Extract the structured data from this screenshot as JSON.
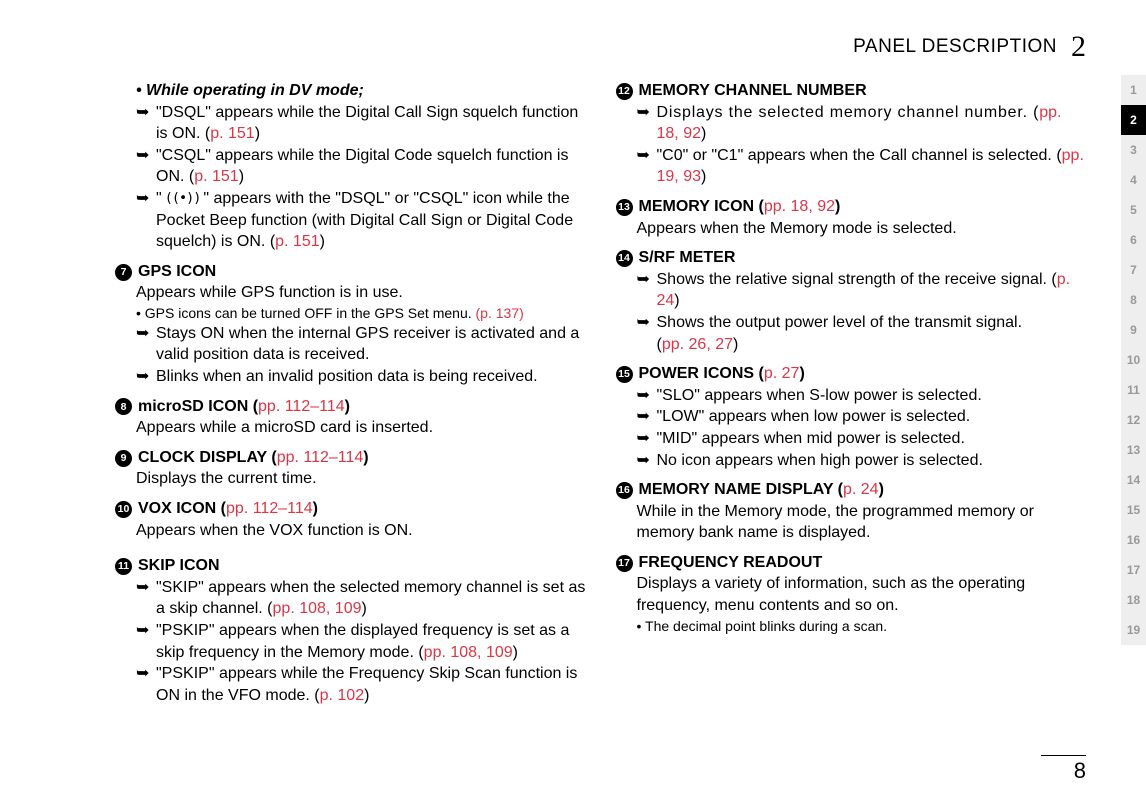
{
  "header": {
    "title": "PANEL DESCRIPTION",
    "chapter": "2"
  },
  "sideTab": {
    "items": [
      "1",
      "2",
      "3",
      "4",
      "5",
      "6",
      "7",
      "8",
      "9",
      "10",
      "11",
      "12",
      "13",
      "14",
      "15",
      "16",
      "17",
      "18",
      "19"
    ],
    "activeIndex": 1
  },
  "left": {
    "dvHeading": "• While operating in DV mode;",
    "dv1a": "\"DSQL\" appears while the Digital Call Sign squelch function is ON. (",
    "dv1ref": "p. 151",
    "dv1b": ")",
    "dv2a": "\"CSQL\" appears while the Digital Code squelch function is ON. (",
    "dv2ref": "p. 151",
    "dv2b": ")",
    "dv3a": "\"",
    "dv3icon": "((•))",
    "dv3b": "\" appears with the \"DSQL\" or \"CSQL\" icon while the Pocket Beep function (with Digital Call Sign or Digital Code squelch) is ON. (",
    "dv3ref": "p. 151",
    "dv3c": ")",
    "n7": "7",
    "h7": "GPS ICON",
    "h7l1": "Appears while GPS function is in use.",
    "h7note": "• GPS icons can be turned OFF in the GPS Set menu. ",
    "h7noteRef": "(p. 137)",
    "h7b1": "Stays ON when the internal GPS receiver is activated and a valid position data is received.",
    "h7b2": "Blinks when an invalid position data is being received.",
    "n8": "8",
    "h8a": "microSD ICON (",
    "h8ref": "pp. 112–114",
    "h8b": ")",
    "h8l1": "Appears while a microSD card is inserted.",
    "n9": "9",
    "h9a": "CLOCK DISPLAY (",
    "h9ref": "pp. 112–114",
    "h9b": ")",
    "h9l1": "Displays the current time.",
    "n10": "10",
    "h10a": "VOX ICON (",
    "h10ref": "pp. 112–114",
    "h10b": ")",
    "h10l1": "Appears when the VOX function is ON.",
    "n11": "11",
    "h11": "SKIP ICON",
    "h11b1a": "\"SKIP\" appears when the selected memory channel is set as a skip channel. (",
    "h11b1ref": "pp. 108, 109",
    "h11b1b": ")",
    "h11b2a": "\"PSKIP\" appears when the displayed frequency is set as a skip frequency in the Memory mode. (",
    "h11b2ref": "pp. 108, 109",
    "h11b2b": ")",
    "h11b3a": "\"PSKIP\" appears while the Frequency Skip Scan function is ON in the VFO mode. (",
    "h11b3ref": "p. 102",
    "h11b3b": ")"
  },
  "right": {
    "n12": "12",
    "h12": "MEMORY CHANNEL NUMBER",
    "h12b1a": "Displays the selected memory channel number. (",
    "h12b1ref": "pp. 18, 92",
    "h12b1b": ")",
    "h12b2a": "\"C0\" or \"C1\" appears when the Call channel is selected. (",
    "h12b2ref": "pp. 19, 93",
    "h12b2b": ")",
    "n13": "13",
    "h13a": "MEMORY ICON (",
    "h13ref": "pp. 18, 92",
    "h13b": ")",
    "h13l1": "Appears when the Memory mode is selected.",
    "n14": "14",
    "h14": "S/RF METER",
    "h14b1a": "Shows the relative signal strength of the receive signal. (",
    "h14b1ref": "p. 24",
    "h14b1b": ")",
    "h14b2a": "Shows the output power level of the transmit signal.",
    "h14b2refOpen": "(",
    "h14b2ref": "pp. 26, 27",
    "h14b2b": ")",
    "n15": "15",
    "h15a": "POWER ICONS (",
    "h15ref": "p. 27",
    "h15b": ")",
    "h15b1": "\"SLO\" appears when S-low power is selected.",
    "h15b2": "\"LOW\" appears when low power is selected.",
    "h15b3": "\"MID\" appears when mid power is selected.",
    "h15b4": "No icon appears when high power is selected.",
    "n16": "16",
    "h16a": "MEMORY NAME DISPLAY (",
    "h16ref": "p. 24",
    "h16b": ")",
    "h16l1": "While in the Memory mode, the programmed memory or memory bank name is displayed.",
    "n17": "17",
    "h17": "FREQUENCY READOUT",
    "h17l1": "Displays a variety of information, such as the operating frequency, menu contents and so on.",
    "h17note": "• The decimal point blinks during a scan."
  },
  "pageNum": "8",
  "arrow": "➥"
}
